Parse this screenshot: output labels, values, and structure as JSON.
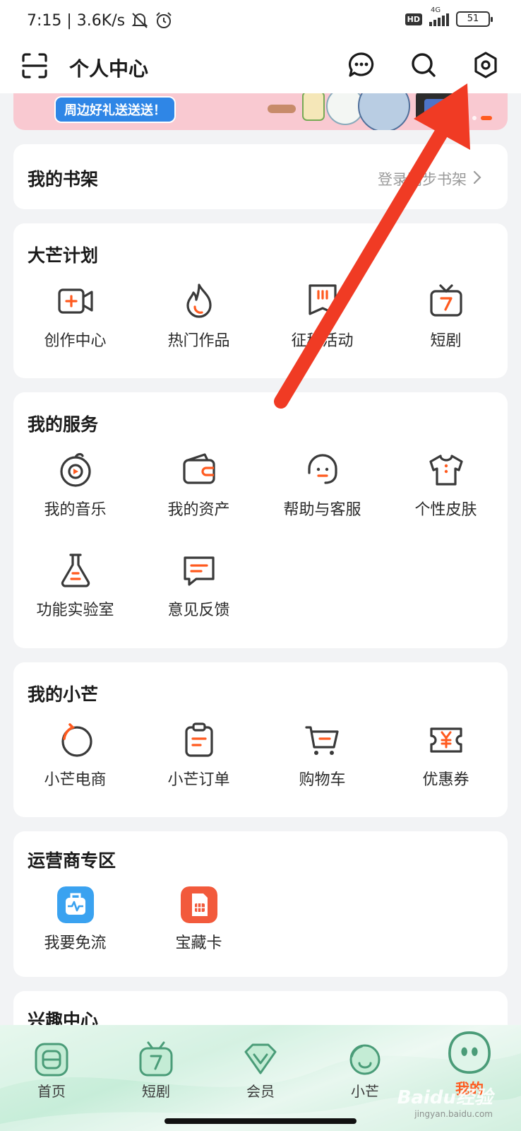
{
  "status_bar": {
    "time_speed": "7:15 | 3.6K/s",
    "hd": "HD",
    "network": "4G",
    "battery": "51"
  },
  "header": {
    "title": "个人中心"
  },
  "banner": {
    "tag": "周边好礼送送送！"
  },
  "bookshelf": {
    "title": "我的书架",
    "hint": "登录同步书架"
  },
  "dama_plan": {
    "title": "大芒计划",
    "items": [
      {
        "label": "创作中心",
        "icon": "video-plus-icon"
      },
      {
        "label": "热门作品",
        "icon": "flame-icon"
      },
      {
        "label": "征稿活动",
        "icon": "bookmark-icon"
      },
      {
        "label": "短剧",
        "icon": "tv-icon"
      }
    ]
  },
  "my_services": {
    "title": "我的服务",
    "items": [
      {
        "label": "我的音乐",
        "icon": "music-disc-icon"
      },
      {
        "label": "我的资产",
        "icon": "wallet-icon"
      },
      {
        "label": "帮助与客服",
        "icon": "headset-icon"
      },
      {
        "label": "个性皮肤",
        "icon": "tshirt-icon"
      },
      {
        "label": "功能实验室",
        "icon": "flask-icon"
      },
      {
        "label": "意见反馈",
        "icon": "feedback-icon"
      }
    ]
  },
  "my_xiaomang": {
    "title": "我的小芒",
    "items": [
      {
        "label": "小芒电商",
        "icon": "xiaomang-circle-icon"
      },
      {
        "label": "小芒订单",
        "icon": "clipboard-icon"
      },
      {
        "label": "购物车",
        "icon": "cart-icon"
      },
      {
        "label": "优惠券",
        "icon": "coupon-icon"
      }
    ]
  },
  "operator_zone": {
    "title": "运营商专区",
    "items": [
      {
        "label": "我要免流",
        "icon": "free-data-icon",
        "color": "#3aa2f0"
      },
      {
        "label": "宝藏卡",
        "icon": "sim-card-icon",
        "color": "#f25a3c"
      }
    ]
  },
  "interest_center": {
    "title": "兴趣中心"
  },
  "tabbar": {
    "items": [
      {
        "label": "首页",
        "icon": "home-tab-icon"
      },
      {
        "label": "短剧",
        "icon": "short-drama-tab-icon"
      },
      {
        "label": "会员",
        "icon": "vip-tab-icon"
      },
      {
        "label": "小芒",
        "icon": "xiaomang-tab-icon"
      },
      {
        "label": "我的",
        "icon": "mine-tab-icon"
      }
    ]
  },
  "watermark": {
    "text": "Baidu经验",
    "url": "jingyan.baidu.com"
  },
  "colors": {
    "accent": "#ff5a1f",
    "icon_stroke": "#3a3a3a",
    "arrow": "#f03b24",
    "background": "#f2f3f5"
  }
}
